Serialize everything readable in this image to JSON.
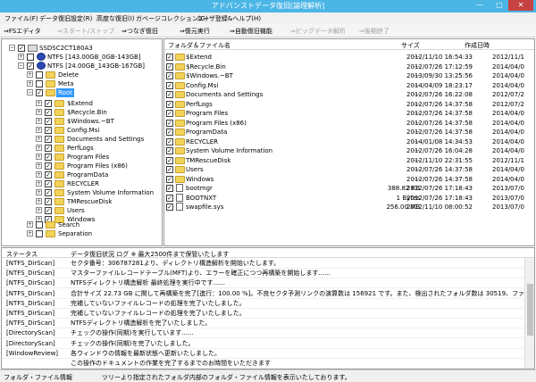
{
  "window": {
    "title": "アドバンストデータ復旧[論理解析]",
    "min": "—",
    "max": "□",
    "close": "✕"
  },
  "menu": [
    "ファイル(F)",
    "データ復旧設定(R)",
    "高度な復旧(I)",
    "ガベージコレクション(G)",
    "ユーザ登録&ヘルプ(H)"
  ],
  "toolbar": {
    "fs_editor": "⇒FSエディタ",
    "start_stop": "⇒スタート/ストップ",
    "resume": "⇒つなぎ復旧",
    "complete": "⇒復元実行",
    "auto_restore": "⇒自動復旧機能",
    "big_data": "⇒ビッグデータ解析",
    "end": "⇒後期終了"
  },
  "tree": {
    "disk": "SSDSC2CT180A3",
    "partitions": [
      "NTFS [143.00GB_0GB-143GB]",
      "NTFS [24.00GB_143GB-167GB]"
    ],
    "delete": "Delete",
    "meta": "Meta",
    "root": "Root",
    "root_children": [
      "$Extend",
      "$Recycle.Bin",
      "$Windows.~BT",
      "Config.Msi",
      "Documents and Settings",
      "PerfLogs",
      "Program Files",
      "Program Files (x86)",
      "ProgramData",
      "RECYCLER",
      "System Volume Information",
      "TMRescueDisk",
      "Users",
      "Windows"
    ],
    "search": "Search",
    "separation": "Separation"
  },
  "list": {
    "headers": {
      "name": "フォルダ＆ファイル名",
      "size": "サイズ",
      "date": "作成日時"
    },
    "rows": [
      {
        "name": "$Extend",
        "size": "---",
        "date": "2012/11/10 16:54:33",
        "date2": "2012/11/1",
        "kind": "folder"
      },
      {
        "name": "$Recycle.Bin",
        "size": "---",
        "date": "2012/07/26 17:12:59",
        "date2": "2014/04/0",
        "kind": "folder"
      },
      {
        "name": "$Windows.~BT",
        "size": "---",
        "date": "2013/09/30 13:25:56",
        "date2": "2014/04/0",
        "kind": "folder"
      },
      {
        "name": "Config.Msi",
        "size": "---",
        "date": "2014/04/09 18:23:17",
        "date2": "2014/04/0",
        "kind": "folder"
      },
      {
        "name": "Documents and Settings",
        "size": "---",
        "date": "2012/07/26 16:22:08",
        "date2": "2012/07/2",
        "kind": "folder"
      },
      {
        "name": "PerfLogs",
        "size": "---",
        "date": "2012/07/26 14:37:58",
        "date2": "2012/07/2",
        "kind": "folder"
      },
      {
        "name": "Program Files",
        "size": "---",
        "date": "2012/07/26 14:37:58",
        "date2": "2014/04/0",
        "kind": "folder"
      },
      {
        "name": "Program Files (x86)",
        "size": "---",
        "date": "2012/07/26 14:37:58",
        "date2": "2014/04/0",
        "kind": "folder"
      },
      {
        "name": "ProgramData",
        "size": "---",
        "date": "2012/07/26 14:37:58",
        "date2": "2014/04/0",
        "kind": "folder"
      },
      {
        "name": "RECYCLER",
        "size": "---",
        "date": "2014/01/08 14:34:53",
        "date2": "2014/04/0",
        "kind": "folder"
      },
      {
        "name": "System Volume Information",
        "size": "---",
        "date": "2012/07/26 16:04:28",
        "date2": "2014/04/0",
        "kind": "folder"
      },
      {
        "name": "TMRescueDisk",
        "size": "---",
        "date": "2012/11/10 22:31:55",
        "date2": "2012/11/1",
        "kind": "folder"
      },
      {
        "name": "Users",
        "size": "---",
        "date": "2012/07/26 14:37:58",
        "date2": "2014/04/0",
        "kind": "folder"
      },
      {
        "name": "Windows",
        "size": "---",
        "date": "2012/07/26 14:37:58",
        "date2": "2014/04/0",
        "kind": "folder"
      },
      {
        "name": "bootmgr",
        "size": "388.82 KB",
        "date": "2012/07/26 17:18:43",
        "date2": "2013/07/0",
        "kind": "file"
      },
      {
        "name": "BOOTNXT",
        "size": "1 Bytes",
        "date": "2012/07/26 17:18:43",
        "date2": "2013/07/0",
        "kind": "file"
      },
      {
        "name": "swapfile.sys",
        "size": "256.00 MB",
        "date": "2012/11/10 08:00:52",
        "date2": "2013/07/0",
        "kind": "file"
      }
    ]
  },
  "log": {
    "headers": {
      "status": "ステータス",
      "message": "データ復旧状況 ログ ※ 最大2500件まで保管いたします"
    },
    "rows": [
      {
        "tag": "[NTFS_DirScan]",
        "msg": "セクタ番号：306787281より、ディレクトリ構造解析を開始いたします。"
      },
      {
        "tag": "[NTFS_DirScan]",
        "msg": "マスターファイルレコードテーブル(MFT)より、エラーを確正につつ再構築を開始します......"
      },
      {
        "tag": "[NTFS_DirScan]",
        "msg": "NTFSディレクトリ構造解析 最終処理を実行中です......"
      },
      {
        "tag": "[NTFS_DirScan]",
        "msg": "合計サイズ 22.73 GB に関して再構築を完了[進行：100.00 %]。不良セクタ予測リンクの演算数は 156921 です。また、検出されたフォルダ数は 30519、ファイル数は 126402 です。"
      },
      {
        "tag": "[NTFS_DirScan]",
        "msg": "完補していないファイルレコードの処理を完了いたしました。"
      },
      {
        "tag": "[NTFS_DirScan]",
        "msg": "完補していないファイルレコードの処理を完了いたしました。"
      },
      {
        "tag": "[NTFS_DirScan]",
        "msg": "NTFSディレクトリ構造解析を完了いたしました。"
      },
      {
        "tag": "[DirectoryScan]",
        "msg": "チェックの操作(同期)を実行しています......"
      },
      {
        "tag": "[DirectoryScan]",
        "msg": "チェックの操作(同期)を完了いたしました。"
      },
      {
        "tag": "[WindowReview]",
        "msg": "各ウィンドウの情報を最新状態へ更新いたしました。"
      },
      {
        "tag": "",
        "msg": "この操作のドキュメントの作業を完了するまでのお時間をいただきます"
      }
    ]
  },
  "status": {
    "left": "フォルダ・ファイル情報",
    "right": "ツリーより指定されたフォルダ内部のフォルダ・ファイル情報を表示いたしております。"
  }
}
